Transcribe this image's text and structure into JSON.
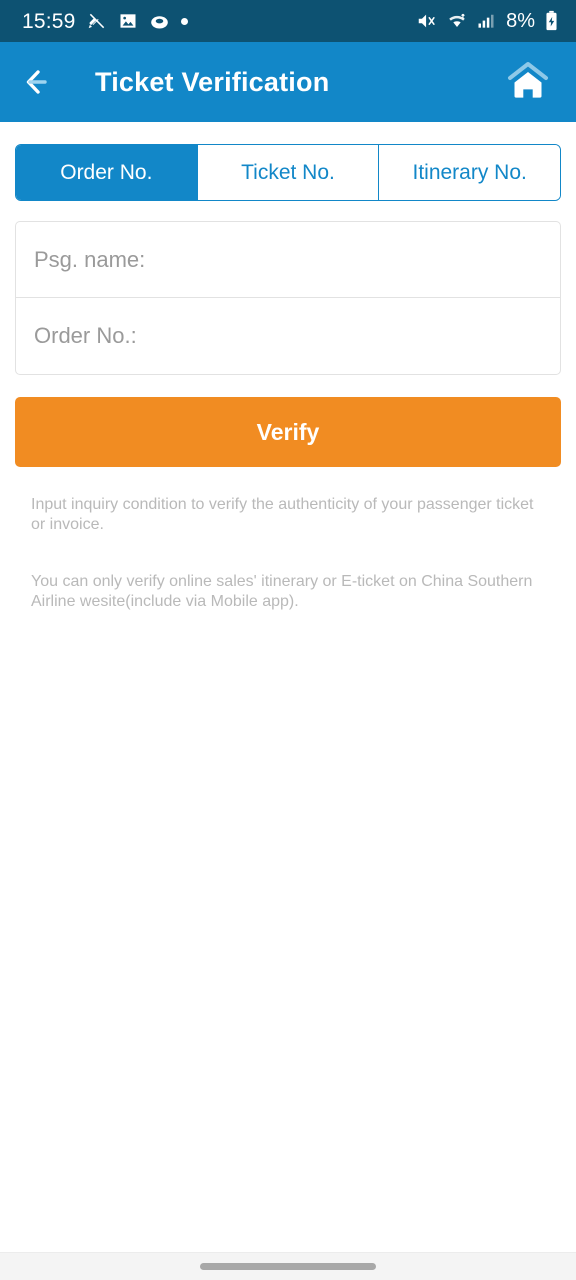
{
  "status_bar": {
    "time": "15:59",
    "battery_percent": "8%",
    "left_icons": [
      "silent-mode-icon",
      "photo-icon",
      "disc-icon",
      "dot-icon"
    ],
    "right_icons": [
      "volume-muted-icon",
      "wifi-icon",
      "cellular-signal-icon",
      "battery-charging-icon"
    ],
    "background_color": "#0d5272"
  },
  "app_bar": {
    "title": "Ticket Verification",
    "back_icon": "arrow-left-icon",
    "home_icon": "home-icon",
    "background_color": "#1287c8"
  },
  "tabs": [
    {
      "label": "Order No.",
      "active": true
    },
    {
      "label": "Ticket No.",
      "active": false
    },
    {
      "label": "Itinerary No.",
      "active": false
    }
  ],
  "form": {
    "passenger_name": {
      "placeholder": "Psg. name:",
      "value": ""
    },
    "order_no": {
      "placeholder": "Order No.:",
      "value": ""
    },
    "submit_label": "Verify",
    "submit_color": "#f18c22"
  },
  "help": {
    "paragraph_1": "Input inquiry condition to verify the authenticity of your passenger ticket or invoice.",
    "paragraph_2": "You can only verify online sales' itinerary or E-ticket on China Southern Airline wesite(include via Mobile app)."
  },
  "nav_bar": {
    "handle": "gesture-pill-handle"
  }
}
